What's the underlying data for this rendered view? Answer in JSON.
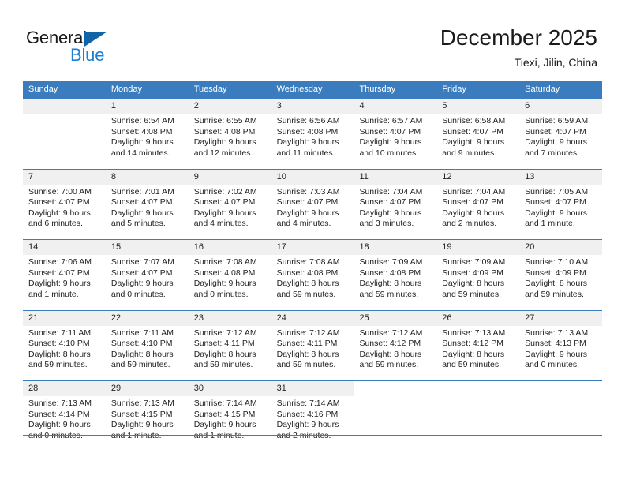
{
  "brand": {
    "name_part1": "General",
    "name_part2": "Blue",
    "flag_icon": "blue-triangle-flag-icon",
    "accent_color": "#1b7fd4",
    "flag_color": "#1264a8"
  },
  "header": {
    "title": "December 2025",
    "subtitle": "Tiexi, Jilin, China"
  },
  "calendar": {
    "header_bg_color": "#3a7cbe",
    "daynum_band_color": "#f0f0f0",
    "weekdays": [
      "Sunday",
      "Monday",
      "Tuesday",
      "Wednesday",
      "Thursday",
      "Friday",
      "Saturday"
    ],
    "weeks": [
      [
        {
          "day": "",
          "blank": true
        },
        {
          "day": "1",
          "sunrise": "Sunrise: 6:54 AM",
          "sunset": "Sunset: 4:08 PM",
          "daylight_line1": "Daylight: 9 hours",
          "daylight_line2": "and 14 minutes."
        },
        {
          "day": "2",
          "sunrise": "Sunrise: 6:55 AM",
          "sunset": "Sunset: 4:08 PM",
          "daylight_line1": "Daylight: 9 hours",
          "daylight_line2": "and 12 minutes."
        },
        {
          "day": "3",
          "sunrise": "Sunrise: 6:56 AM",
          "sunset": "Sunset: 4:08 PM",
          "daylight_line1": "Daylight: 9 hours",
          "daylight_line2": "and 11 minutes."
        },
        {
          "day": "4",
          "sunrise": "Sunrise: 6:57 AM",
          "sunset": "Sunset: 4:07 PM",
          "daylight_line1": "Daylight: 9 hours",
          "daylight_line2": "and 10 minutes."
        },
        {
          "day": "5",
          "sunrise": "Sunrise: 6:58 AM",
          "sunset": "Sunset: 4:07 PM",
          "daylight_line1": "Daylight: 9 hours",
          "daylight_line2": "and 9 minutes."
        },
        {
          "day": "6",
          "sunrise": "Sunrise: 6:59 AM",
          "sunset": "Sunset: 4:07 PM",
          "daylight_line1": "Daylight: 9 hours",
          "daylight_line2": "and 7 minutes."
        }
      ],
      [
        {
          "day": "7",
          "sunrise": "Sunrise: 7:00 AM",
          "sunset": "Sunset: 4:07 PM",
          "daylight_line1": "Daylight: 9 hours",
          "daylight_line2": "and 6 minutes."
        },
        {
          "day": "8",
          "sunrise": "Sunrise: 7:01 AM",
          "sunset": "Sunset: 4:07 PM",
          "daylight_line1": "Daylight: 9 hours",
          "daylight_line2": "and 5 minutes."
        },
        {
          "day": "9",
          "sunrise": "Sunrise: 7:02 AM",
          "sunset": "Sunset: 4:07 PM",
          "daylight_line1": "Daylight: 9 hours",
          "daylight_line2": "and 4 minutes."
        },
        {
          "day": "10",
          "sunrise": "Sunrise: 7:03 AM",
          "sunset": "Sunset: 4:07 PM",
          "daylight_line1": "Daylight: 9 hours",
          "daylight_line2": "and 4 minutes."
        },
        {
          "day": "11",
          "sunrise": "Sunrise: 7:04 AM",
          "sunset": "Sunset: 4:07 PM",
          "daylight_line1": "Daylight: 9 hours",
          "daylight_line2": "and 3 minutes."
        },
        {
          "day": "12",
          "sunrise": "Sunrise: 7:04 AM",
          "sunset": "Sunset: 4:07 PM",
          "daylight_line1": "Daylight: 9 hours",
          "daylight_line2": "and 2 minutes."
        },
        {
          "day": "13",
          "sunrise": "Sunrise: 7:05 AM",
          "sunset": "Sunset: 4:07 PM",
          "daylight_line1": "Daylight: 9 hours",
          "daylight_line2": "and 1 minute."
        }
      ],
      [
        {
          "day": "14",
          "sunrise": "Sunrise: 7:06 AM",
          "sunset": "Sunset: 4:07 PM",
          "daylight_line1": "Daylight: 9 hours",
          "daylight_line2": "and 1 minute."
        },
        {
          "day": "15",
          "sunrise": "Sunrise: 7:07 AM",
          "sunset": "Sunset: 4:07 PM",
          "daylight_line1": "Daylight: 9 hours",
          "daylight_line2": "and 0 minutes."
        },
        {
          "day": "16",
          "sunrise": "Sunrise: 7:08 AM",
          "sunset": "Sunset: 4:08 PM",
          "daylight_line1": "Daylight: 9 hours",
          "daylight_line2": "and 0 minutes."
        },
        {
          "day": "17",
          "sunrise": "Sunrise: 7:08 AM",
          "sunset": "Sunset: 4:08 PM",
          "daylight_line1": "Daylight: 8 hours",
          "daylight_line2": "and 59 minutes."
        },
        {
          "day": "18",
          "sunrise": "Sunrise: 7:09 AM",
          "sunset": "Sunset: 4:08 PM",
          "daylight_line1": "Daylight: 8 hours",
          "daylight_line2": "and 59 minutes."
        },
        {
          "day": "19",
          "sunrise": "Sunrise: 7:09 AM",
          "sunset": "Sunset: 4:09 PM",
          "daylight_line1": "Daylight: 8 hours",
          "daylight_line2": "and 59 minutes."
        },
        {
          "day": "20",
          "sunrise": "Sunrise: 7:10 AM",
          "sunset": "Sunset: 4:09 PM",
          "daylight_line1": "Daylight: 8 hours",
          "daylight_line2": "and 59 minutes."
        }
      ],
      [
        {
          "day": "21",
          "sunrise": "Sunrise: 7:11 AM",
          "sunset": "Sunset: 4:10 PM",
          "daylight_line1": "Daylight: 8 hours",
          "daylight_line2": "and 59 minutes."
        },
        {
          "day": "22",
          "sunrise": "Sunrise: 7:11 AM",
          "sunset": "Sunset: 4:10 PM",
          "daylight_line1": "Daylight: 8 hours",
          "daylight_line2": "and 59 minutes."
        },
        {
          "day": "23",
          "sunrise": "Sunrise: 7:12 AM",
          "sunset": "Sunset: 4:11 PM",
          "daylight_line1": "Daylight: 8 hours",
          "daylight_line2": "and 59 minutes."
        },
        {
          "day": "24",
          "sunrise": "Sunrise: 7:12 AM",
          "sunset": "Sunset: 4:11 PM",
          "daylight_line1": "Daylight: 8 hours",
          "daylight_line2": "and 59 minutes."
        },
        {
          "day": "25",
          "sunrise": "Sunrise: 7:12 AM",
          "sunset": "Sunset: 4:12 PM",
          "daylight_line1": "Daylight: 8 hours",
          "daylight_line2": "and 59 minutes."
        },
        {
          "day": "26",
          "sunrise": "Sunrise: 7:13 AM",
          "sunset": "Sunset: 4:12 PM",
          "daylight_line1": "Daylight: 8 hours",
          "daylight_line2": "and 59 minutes."
        },
        {
          "day": "27",
          "sunrise": "Sunrise: 7:13 AM",
          "sunset": "Sunset: 4:13 PM",
          "daylight_line1": "Daylight: 9 hours",
          "daylight_line2": "and 0 minutes."
        }
      ],
      [
        {
          "day": "28",
          "sunrise": "Sunrise: 7:13 AM",
          "sunset": "Sunset: 4:14 PM",
          "daylight_line1": "Daylight: 9 hours",
          "daylight_line2": "and 0 minutes."
        },
        {
          "day": "29",
          "sunrise": "Sunrise: 7:13 AM",
          "sunset": "Sunset: 4:15 PM",
          "daylight_line1": "Daylight: 9 hours",
          "daylight_line2": "and 1 minute."
        },
        {
          "day": "30",
          "sunrise": "Sunrise: 7:14 AM",
          "sunset": "Sunset: 4:15 PM",
          "daylight_line1": "Daylight: 9 hours",
          "daylight_line2": "and 1 minute."
        },
        {
          "day": "31",
          "sunrise": "Sunrise: 7:14 AM",
          "sunset": "Sunset: 4:16 PM",
          "daylight_line1": "Daylight: 9 hours",
          "daylight_line2": "and 2 minutes."
        },
        {
          "day": "",
          "blank": true,
          "nofill": true
        },
        {
          "day": "",
          "blank": true,
          "nofill": true
        },
        {
          "day": "",
          "blank": true,
          "nofill": true
        }
      ]
    ]
  }
}
